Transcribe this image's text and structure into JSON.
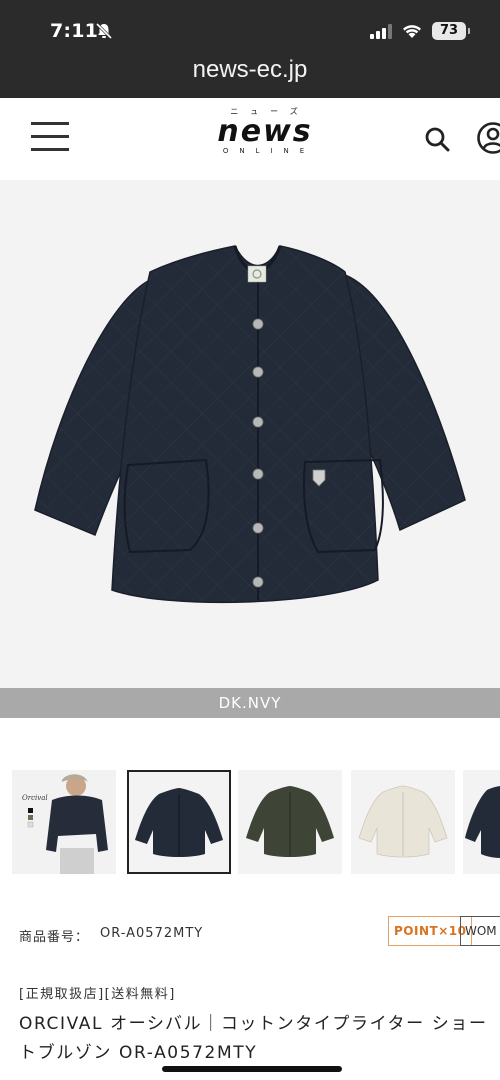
{
  "status": {
    "time": "7:11",
    "battery": "73"
  },
  "browser": {
    "url": "news-ec.jp"
  },
  "header": {
    "logo_kana": "ニューズ",
    "logo_main": "news",
    "logo_sub": "ONLINE"
  },
  "product": {
    "color_label": "DK.NVY",
    "sku_label": "商品番号：",
    "sku_value": "OR-A0572MTY",
    "badge_point": "POINT×10",
    "badge_category": "WOM",
    "tags": "[正規取扱店][送料無料]",
    "title": "ORCIVAL オーシバル｜コットンタイプライター ショートブルゾン OR-A0572MTY"
  },
  "thumbnails": [
    {
      "name": "model-photo",
      "brand_text": "Orcival"
    },
    {
      "name": "navy"
    },
    {
      "name": "olive"
    },
    {
      "name": "ivory"
    },
    {
      "name": "navy-partial"
    }
  ],
  "colors": {
    "chrome_bg": "#2b2b2b",
    "jacket_navy": "#232a38",
    "jacket_olive": "#3f4536",
    "jacket_ivory": "#e9e4d8",
    "color_bar": "#a9a9a9",
    "point_badge": "#d9731f"
  },
  "icons": [
    "bell-slash-icon",
    "signal-icon",
    "wifi-icon",
    "battery-icon",
    "hamburger-icon",
    "search-icon",
    "account-icon"
  ]
}
